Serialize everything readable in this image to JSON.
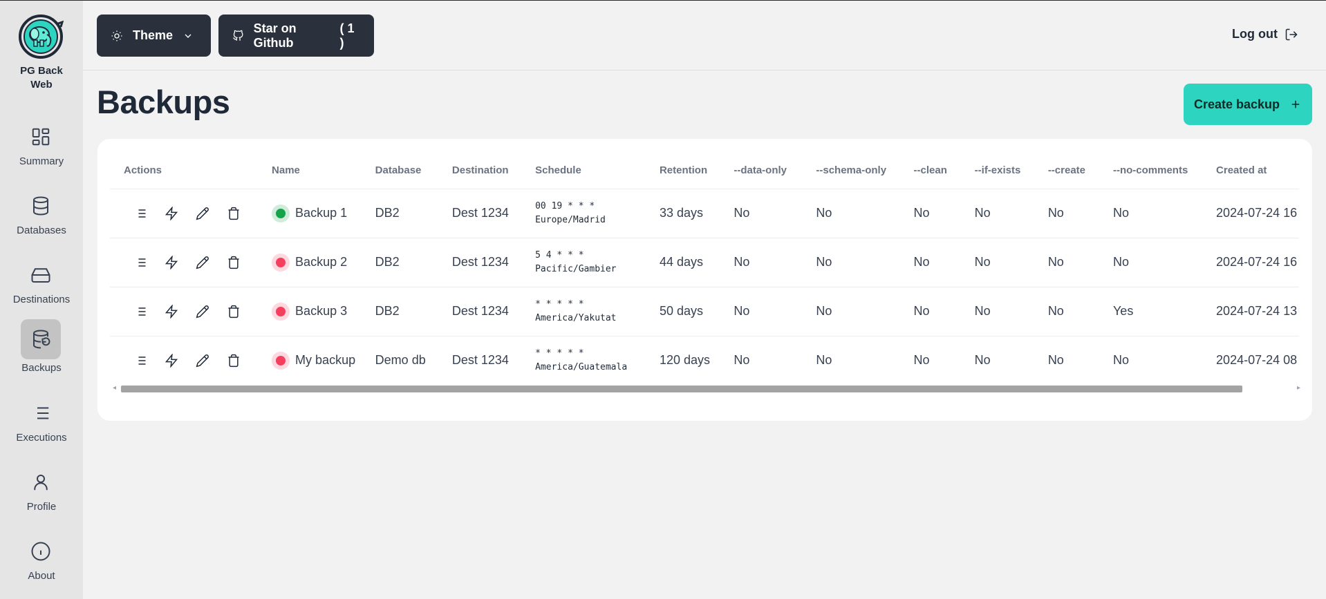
{
  "brand": {
    "name_line1": "PG Back",
    "name_line2": "Web"
  },
  "sidebar": {
    "items": [
      {
        "label": "Summary",
        "icon": "summary-icon"
      },
      {
        "label": "Databases",
        "icon": "database-icon"
      },
      {
        "label": "Destinations",
        "icon": "hard-drive-icon"
      },
      {
        "label": "Backups",
        "icon": "database-backup-icon",
        "active": true
      },
      {
        "label": "Executions",
        "icon": "list-icon"
      },
      {
        "label": "Profile",
        "icon": "user-icon"
      },
      {
        "label": "About",
        "icon": "info-icon"
      }
    ]
  },
  "topbar": {
    "theme_label": "Theme",
    "github_label": "Star on Github",
    "github_count": "( 1 )",
    "logout_label": "Log out"
  },
  "page": {
    "title": "Backups",
    "create_label": "Create backup"
  },
  "table": {
    "columns": [
      "Actions",
      "Name",
      "Database",
      "Destination",
      "Schedule",
      "Retention",
      "--data-only",
      "--schema-only",
      "--clean",
      "--if-exists",
      "--create",
      "--no-comments",
      "Created at"
    ],
    "rows": [
      {
        "name": "Backup 1",
        "active": true,
        "database": "DB2",
        "destination": "Dest 1234",
        "cron": "00 19 * * *",
        "timezone": "Europe/Madrid",
        "retention": "33 days",
        "data_only": "No",
        "schema_only": "No",
        "clean": "No",
        "if_exists": "No",
        "create": "No",
        "no_comments": "No",
        "created_at": "2024-07-24 16"
      },
      {
        "name": "Backup 2",
        "active": false,
        "database": "DB2",
        "destination": "Dest 1234",
        "cron": "5 4 * * *",
        "timezone": "Pacific/Gambier",
        "retention": "44 days",
        "data_only": "No",
        "schema_only": "No",
        "clean": "No",
        "if_exists": "No",
        "create": "No",
        "no_comments": "No",
        "created_at": "2024-07-24 16"
      },
      {
        "name": "Backup 3",
        "active": false,
        "database": "DB2",
        "destination": "Dest 1234",
        "cron": "* * * * *",
        "timezone": "America/Yakutat",
        "retention": "50 days",
        "data_only": "No",
        "schema_only": "No",
        "clean": "No",
        "if_exists": "No",
        "create": "No",
        "no_comments": "Yes",
        "created_at": "2024-07-24 13"
      },
      {
        "name": "My backup",
        "active": false,
        "database": "Demo db",
        "destination": "Dest 1234",
        "cron": "* * * * *",
        "timezone": "America/Guatemala",
        "retention": "120 days",
        "data_only": "No",
        "schema_only": "No",
        "clean": "No",
        "if_exists": "No",
        "create": "No",
        "no_comments": "No",
        "created_at": "2024-07-24 08"
      }
    ]
  },
  "colors": {
    "accent": "#2dd4bf",
    "dark_button": "#2a303c",
    "status_active": "#16a34a",
    "status_inactive": "#f43f5e"
  }
}
